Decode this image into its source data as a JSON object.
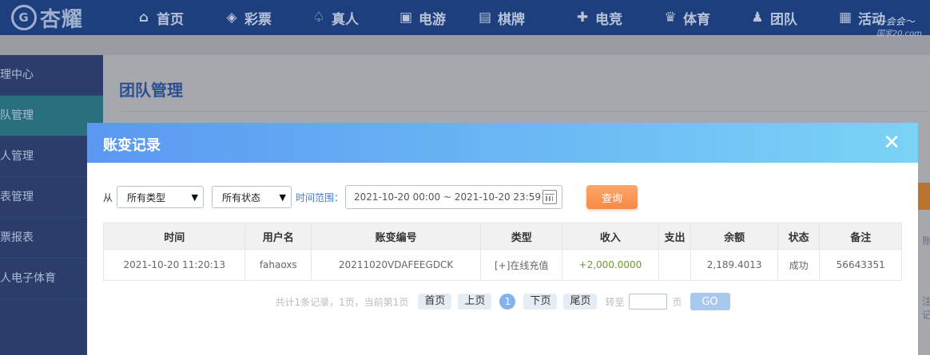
{
  "brand": {
    "name": "杏耀",
    "mark": "G"
  },
  "nav": [
    {
      "label": "首页",
      "icon": "home-icon",
      "glyph": "⌂"
    },
    {
      "label": "彩票",
      "icon": "lottery-icon",
      "glyph": "◈"
    },
    {
      "label": "真人",
      "icon": "live-dealer-icon",
      "glyph": "♤"
    },
    {
      "label": "电游",
      "icon": "slot-game-icon",
      "glyph": "▣"
    },
    {
      "label": "棋牌",
      "icon": "cards-icon",
      "glyph": "▤"
    },
    {
      "label": "电竞",
      "icon": "gamepad-icon",
      "glyph": "✚"
    },
    {
      "label": "体育",
      "icon": "trophy-icon",
      "glyph": "♛"
    },
    {
      "label": "团队",
      "icon": "team-icon",
      "glyph": "♟"
    },
    {
      "label": "活动",
      "icon": "gift-icon",
      "glyph": "▦"
    }
  ],
  "watermark": {
    "line1": "～会会～",
    "line2": "国家20.com"
  },
  "sidebar": {
    "items": [
      {
        "label": "理中心",
        "active": false
      },
      {
        "label": "队管理",
        "active": true
      },
      {
        "label": "人管理",
        "active": false
      },
      {
        "label": "表管理",
        "active": false
      },
      {
        "label": "票报表",
        "active": false
      },
      {
        "label": "人电子体育",
        "active": false
      }
    ]
  },
  "page": {
    "title": "团队管理",
    "edge_text1": "账",
    "edge_text2": "注记"
  },
  "modal": {
    "title": "账变记录",
    "close_glyph": "✕",
    "filter": {
      "from_label": "从",
      "type_select": "所有类型",
      "status_select": "所有状态",
      "time_label": "时间范围：",
      "date_range": "2021-10-20 00:00 ~ 2021-10-20 23:59",
      "query_label": "查询"
    },
    "table": {
      "headers": [
        "时间",
        "用户名",
        "账变编号",
        "类型",
        "收入",
        "支出",
        "余额",
        "状态",
        "备注"
      ],
      "rows": [
        [
          "2021-10-20 11:20:13",
          "fahaoxs",
          "20211020VDAFEEGDCK",
          "[+]在线充值",
          "+2,000.0000",
          "",
          "2,189.4013",
          "成功",
          "56643351"
        ]
      ]
    },
    "pager": {
      "summary": "共计1条记录，1页，当前第1页",
      "first": "首页",
      "prev": "上页",
      "current": "1",
      "next": "下页",
      "last": "尾页",
      "goto_label": "转至",
      "page_unit": "页",
      "go": "GO"
    }
  },
  "colors": {
    "nav_bg": "#1d3f7e",
    "modal_header_start": "#5a98f2",
    "modal_header_end": "#7ad3f6",
    "query_button": "#f78a44",
    "income": "#6a9a2a"
  }
}
